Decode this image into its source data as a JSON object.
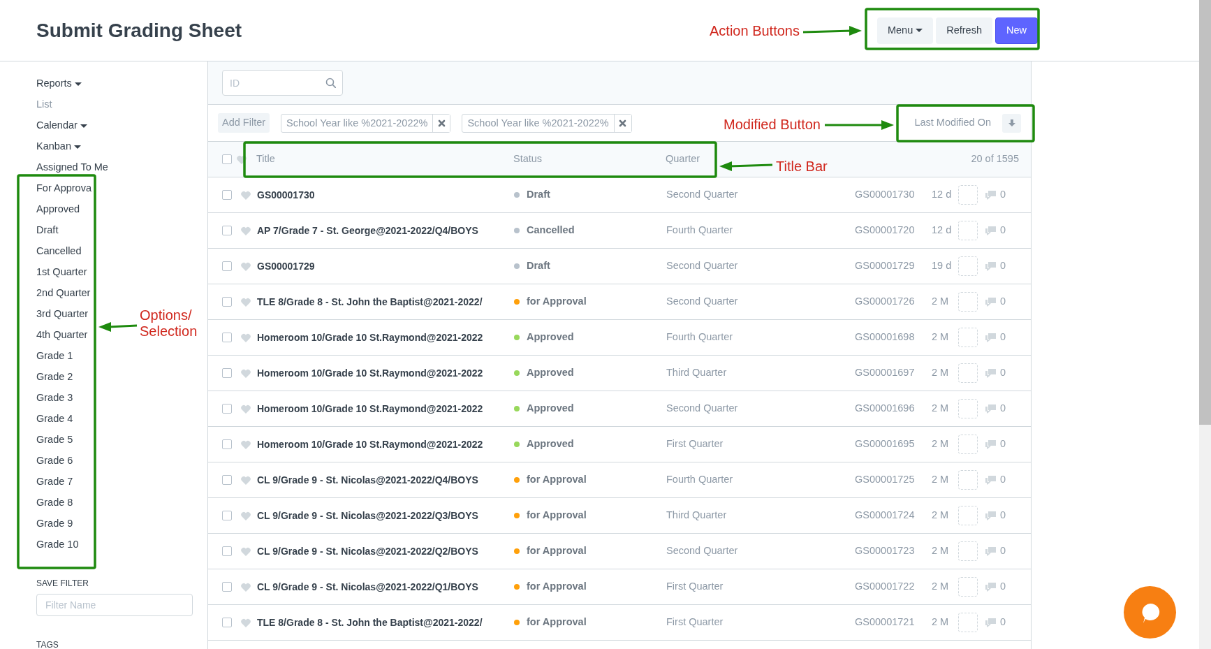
{
  "page": {
    "title": "Submit Grading Sheet"
  },
  "actions": [
    {
      "label": "Menu",
      "kind": "dropdown"
    },
    {
      "label": "Refresh",
      "kind": "default"
    },
    {
      "label": "New",
      "kind": "primary"
    }
  ],
  "sidebar": {
    "items": [
      {
        "label": "Reports",
        "kind": "dropdown",
        "selected": false
      },
      {
        "label": "List",
        "kind": "link",
        "selected": true
      },
      {
        "label": "Calendar",
        "kind": "dropdown",
        "selected": false
      },
      {
        "label": "Kanban",
        "kind": "dropdown",
        "selected": false
      },
      {
        "label": "Assigned To Me",
        "kind": "link",
        "selected": false
      },
      {
        "label": "For Approva",
        "kind": "link",
        "selected": false
      },
      {
        "label": "Approved",
        "kind": "link",
        "selected": false
      },
      {
        "label": "Draft",
        "kind": "link",
        "selected": false
      },
      {
        "label": "Cancelled",
        "kind": "link",
        "selected": false
      },
      {
        "label": "1st Quarter",
        "kind": "link",
        "selected": false
      },
      {
        "label": "2nd Quarter",
        "kind": "link",
        "selected": false
      },
      {
        "label": "3rd Quarter",
        "kind": "link",
        "selected": false
      },
      {
        "label": "4th Quarter",
        "kind": "link",
        "selected": false
      },
      {
        "label": "Grade 1",
        "kind": "link",
        "selected": false
      },
      {
        "label": "Grade 2",
        "kind": "link",
        "selected": false
      },
      {
        "label": "Grade 3",
        "kind": "link",
        "selected": false
      },
      {
        "label": "Grade 4",
        "kind": "link",
        "selected": false
      },
      {
        "label": "Grade 5",
        "kind": "link",
        "selected": false
      },
      {
        "label": "Grade 6",
        "kind": "link",
        "selected": false
      },
      {
        "label": "Grade 7",
        "kind": "link",
        "selected": false
      },
      {
        "label": "Grade 8",
        "kind": "link",
        "selected": false
      },
      {
        "label": "Grade 9",
        "kind": "link",
        "selected": false
      },
      {
        "label": "Grade 10",
        "kind": "link",
        "selected": false
      }
    ],
    "save_filter": {
      "heading": "SAVE FILTER",
      "placeholder": "Filter Name"
    },
    "tags_heading": "TAGS"
  },
  "search": {
    "placeholder": "ID"
  },
  "filters": {
    "add_label": "Add Filter",
    "items": [
      {
        "label": "School Year like %2021-2022%"
      },
      {
        "label": "School Year like %2021-2022%"
      }
    ],
    "sort_label": "Last Modified On"
  },
  "table": {
    "columns": [
      "Title",
      "Status",
      "Quarter"
    ],
    "select_all_checked": false,
    "count": "20 of 1595",
    "rows": [
      {
        "title": "GS00001730",
        "status": "Draft",
        "color": "#b8c2cc",
        "quarter": "Second Quarter",
        "id": "GS00001730",
        "age": "12 d",
        "comments": "0",
        "checked": false
      },
      {
        "title": "AP 7/Grade 7 - St. George@2021-2022/Q4/BOYS",
        "status": "Cancelled",
        "color": "#b8c2cc",
        "quarter": "Fourth Quarter",
        "id": "GS00001720",
        "age": "12 d",
        "comments": "0",
        "checked": false
      },
      {
        "title": "GS00001729",
        "status": "Draft",
        "color": "#b8c2cc",
        "quarter": "Second Quarter",
        "id": "GS00001729",
        "age": "19 d",
        "comments": "0",
        "checked": false
      },
      {
        "title": "TLE 8/Grade 8 - St. John the Baptist@2021-2022/",
        "status": "for Approval",
        "color": "#ffa00a",
        "quarter": "Second Quarter",
        "id": "GS00001726",
        "age": "2 M",
        "comments": "0",
        "checked": false
      },
      {
        "title": "Homeroom 10/Grade 10 St.Raymond@2021-2022",
        "status": "Approved",
        "color": "#98d85b",
        "quarter": "Fourth Quarter",
        "id": "GS00001698",
        "age": "2 M",
        "comments": "0",
        "checked": false
      },
      {
        "title": "Homeroom 10/Grade 10 St.Raymond@2021-2022",
        "status": "Approved",
        "color": "#98d85b",
        "quarter": "Third Quarter",
        "id": "GS00001697",
        "age": "2 M",
        "comments": "0",
        "checked": false
      },
      {
        "title": "Homeroom 10/Grade 10 St.Raymond@2021-2022",
        "status": "Approved",
        "color": "#98d85b",
        "quarter": "Second Quarter",
        "id": "GS00001696",
        "age": "2 M",
        "comments": "0",
        "checked": false
      },
      {
        "title": "Homeroom 10/Grade 10 St.Raymond@2021-2022",
        "status": "Approved",
        "color": "#98d85b",
        "quarter": "First Quarter",
        "id": "GS00001695",
        "age": "2 M",
        "comments": "0",
        "checked": false
      },
      {
        "title": "CL 9/Grade 9 - St. Nicolas@2021-2022/Q4/BOYS",
        "status": "for Approval",
        "color": "#ffa00a",
        "quarter": "Fourth Quarter",
        "id": "GS00001725",
        "age": "2 M",
        "comments": "0",
        "checked": false
      },
      {
        "title": "CL 9/Grade 9 - St. Nicolas@2021-2022/Q3/BOYS",
        "status": "for Approval",
        "color": "#ffa00a",
        "quarter": "Third Quarter",
        "id": "GS00001724",
        "age": "2 M",
        "comments": "0",
        "checked": false
      },
      {
        "title": "CL 9/Grade 9 - St. Nicolas@2021-2022/Q2/BOYS",
        "status": "for Approval",
        "color": "#ffa00a",
        "quarter": "Second Quarter",
        "id": "GS00001723",
        "age": "2 M",
        "comments": "0",
        "checked": false
      },
      {
        "title": "CL 9/Grade 9 - St. Nicolas@2021-2022/Q1/BOYS",
        "status": "for Approval",
        "color": "#ffa00a",
        "quarter": "First Quarter",
        "id": "GS00001722",
        "age": "2 M",
        "comments": "0",
        "checked": false
      },
      {
        "title": "TLE 8/Grade 8 - St. John the Baptist@2021-2022/",
        "status": "for Approval",
        "color": "#ffa00a",
        "quarter": "First Quarter",
        "id": "GS00001721",
        "age": "2 M",
        "comments": "0",
        "checked": false
      }
    ]
  },
  "annotations": [
    {
      "lines": [
        "Action Buttons"
      ]
    },
    {
      "lines": [
        "Modified Button"
      ]
    },
    {
      "lines": [
        "Title Bar"
      ]
    },
    {
      "lines": [
        "Options/",
        "Selection"
      ]
    }
  ]
}
